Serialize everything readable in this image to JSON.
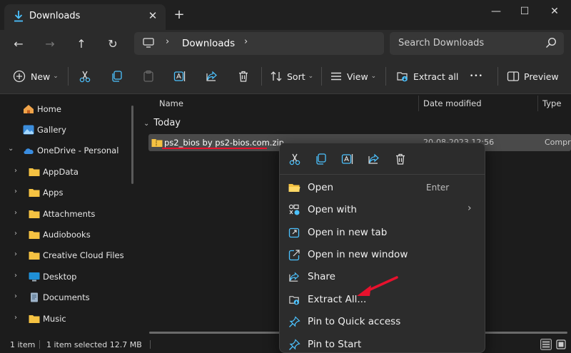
{
  "window": {
    "tab_title": "Downloads",
    "close_tab_glyph": "✕",
    "new_tab_glyph": "+",
    "minimize_glyph": "—",
    "maximize_glyph": "☐",
    "close_glyph": "✕"
  },
  "nav": {
    "back_glyph": "←",
    "forward_glyph": "→",
    "up_glyph": "↑",
    "refresh_glyph": "↻",
    "breadcrumb": "Downloads",
    "separator": "›",
    "search_placeholder": "Search Downloads"
  },
  "commands": {
    "new_label": "New",
    "sort_label": "Sort",
    "view_label": "View",
    "extract_label": "Extract all",
    "more_glyph": "•••",
    "preview_label": "Preview",
    "caret": "⌄"
  },
  "sidebar": {
    "items": [
      {
        "label": "Home",
        "icon": "home-icon"
      },
      {
        "label": "Gallery",
        "icon": "gallery-icon"
      },
      {
        "label": "OneDrive - Personal",
        "icon": "onedrive-icon"
      },
      {
        "label": "AppData",
        "icon": "folder-icon"
      },
      {
        "label": "Apps",
        "icon": "folder-icon"
      },
      {
        "label": "Attachments",
        "icon": "folder-icon"
      },
      {
        "label": "Audiobooks",
        "icon": "folder-icon"
      },
      {
        "label": "Creative Cloud Files",
        "icon": "folder-icon"
      },
      {
        "label": "Desktop",
        "icon": "desktop-icon"
      },
      {
        "label": "Documents",
        "icon": "documents-icon"
      },
      {
        "label": "Music",
        "icon": "folder-icon"
      }
    ],
    "chevron_right": "›",
    "chevron_down": "⌄"
  },
  "filelist": {
    "columns": [
      "Name",
      "Date modified",
      "Type"
    ],
    "group_label": "Today",
    "group_chevron": "⌄",
    "rows": [
      {
        "name": "ps2_bios by ps2-bios.com.zip",
        "date": "20-08-2023 12:56",
        "type": "Compre"
      }
    ]
  },
  "status": {
    "count": "1 item",
    "selection": "1 item selected  12.7 MB"
  },
  "context_menu": {
    "quick_actions": [
      "cut-icon",
      "copy-icon",
      "rename-icon",
      "share-icon",
      "delete-icon"
    ],
    "items": [
      {
        "label": "Open",
        "hint": "Enter",
        "icon": "folder-open-icon"
      },
      {
        "label": "Open with",
        "hint": "",
        "icon": "open-with-icon",
        "submenu": true
      },
      {
        "label": "Open in new tab",
        "hint": "",
        "icon": "new-tab-icon"
      },
      {
        "label": "Open in new window",
        "hint": "",
        "icon": "new-window-icon"
      },
      {
        "label": "Share",
        "hint": "",
        "icon": "share-icon"
      },
      {
        "label": "Extract All...",
        "hint": "",
        "icon": "extract-icon"
      },
      {
        "label": "Pin to Quick access",
        "hint": "",
        "icon": "pin-icon"
      },
      {
        "label": "Pin to Start",
        "hint": "",
        "icon": "pin-icon"
      }
    ],
    "submenu_glyph": "›"
  },
  "colors": {
    "accent": "#4cc2ff",
    "folder": "#f5c242",
    "annotation_red": "#e8112d"
  }
}
